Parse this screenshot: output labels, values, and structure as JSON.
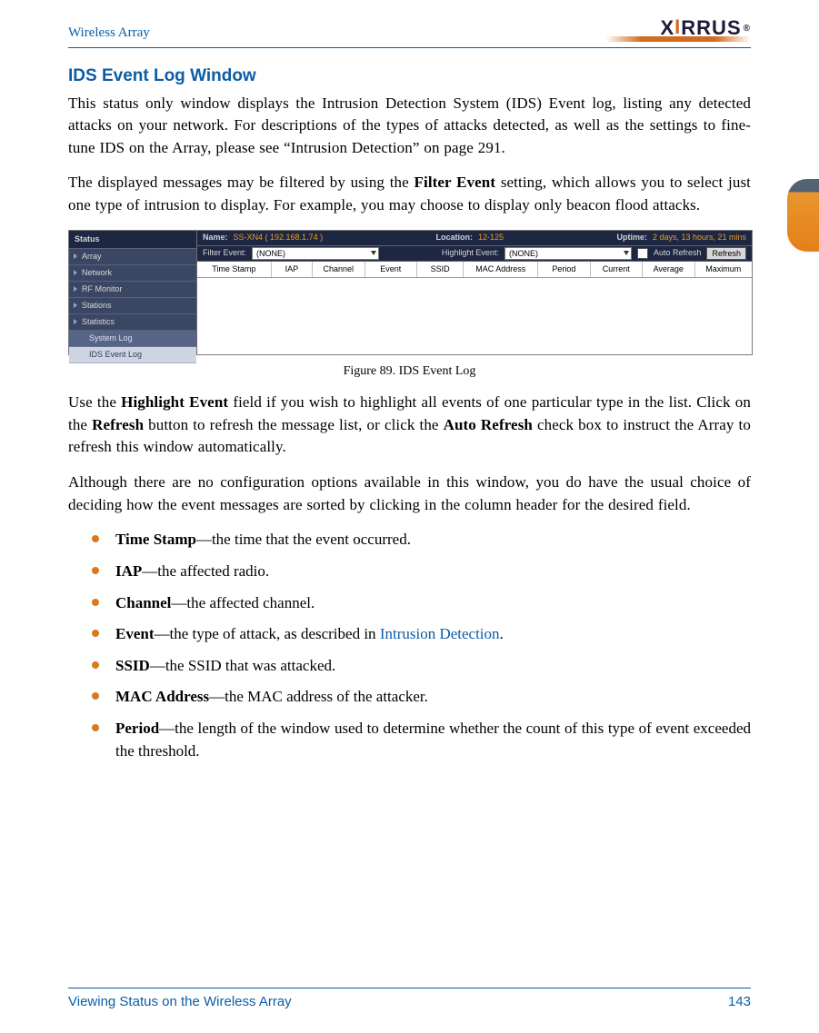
{
  "header": {
    "breadcrumb": "Wireless Array",
    "brand": "XIRRUS"
  },
  "section": {
    "title": "IDS Event Log Window",
    "p1": "This status only window displays the Intrusion Detection System (IDS) Event log, listing any detected attacks on your network. For descriptions of the types of attacks detected, as well as the settings to fine-tune IDS on the Array, please see “Intrusion Detection” on page 291.",
    "p2a": "The displayed messages may be filtered by using the ",
    "p2_bold": "Filter Event",
    "p2b": " setting, which allows you to select just one type of intrusion to display. For example, you may choose to display only beacon flood attacks.",
    "figure_caption": "Figure 89. IDS Event Log",
    "p3a": "Use the ",
    "p3_bold1": "Highlight Event",
    "p3b": " field if you wish to highlight all events of one particular type in the list. Click on the ",
    "p3_bold2": "Refresh",
    "p3c": " button to refresh the message list, or click the ",
    "p3_bold3": "Auto Refresh",
    "p3d": " check box to instruct the Array to refresh this window automatically.",
    "p4": "Although there are no configuration options available in this window, you do have the usual choice of deciding how the event messages are sorted by clicking in the column header for the desired field."
  },
  "bullets": [
    {
      "term": "Time Stamp",
      "desc": "—the time that the event occurred."
    },
    {
      "term": "IAP",
      "desc": "—the affected radio."
    },
    {
      "term": "Channel",
      "desc": "—the affected channel."
    },
    {
      "term": "Event",
      "desc": "—the type of attack, as described in ",
      "link": "Intrusion Detection",
      "tail": "."
    },
    {
      "term": "SSID",
      "desc": "—the SSID that was attacked."
    },
    {
      "term": "MAC Address",
      "desc": "—the MAC address of the attacker."
    },
    {
      "term": "Period",
      "desc": "—the length of the window used to determine whether the count of this type of event exceeded the threshold."
    }
  ],
  "ids_ui": {
    "sidebar": {
      "heading": "Status",
      "items": [
        "Array",
        "Network",
        "RF Monitor",
        "Stations",
        "Statistics"
      ],
      "sub": "System Log",
      "selected": "IDS Event Log"
    },
    "bar1": {
      "name_label": "Name:",
      "name_value": "SS-XN4   ( 192.168.1.74 )",
      "loc_label": "Location:",
      "loc_value": "12-125",
      "uptime_label": "Uptime:",
      "uptime_value": "2 days, 13 hours, 21 mins"
    },
    "bar2": {
      "filter_label": "Filter Event:",
      "filter_value": "(NONE)",
      "highlight_label": "Highlight Event:",
      "highlight_value": "(NONE)",
      "auto_refresh": "Auto Refresh",
      "refresh_btn": "Refresh"
    },
    "columns": [
      "Time Stamp",
      "IAP",
      "Channel",
      "Event",
      "SSID",
      "MAC Address",
      "Period",
      "Current",
      "Average",
      "Maximum"
    ]
  },
  "footer": {
    "left": "Viewing Status on the Wireless Array",
    "right": "143"
  }
}
